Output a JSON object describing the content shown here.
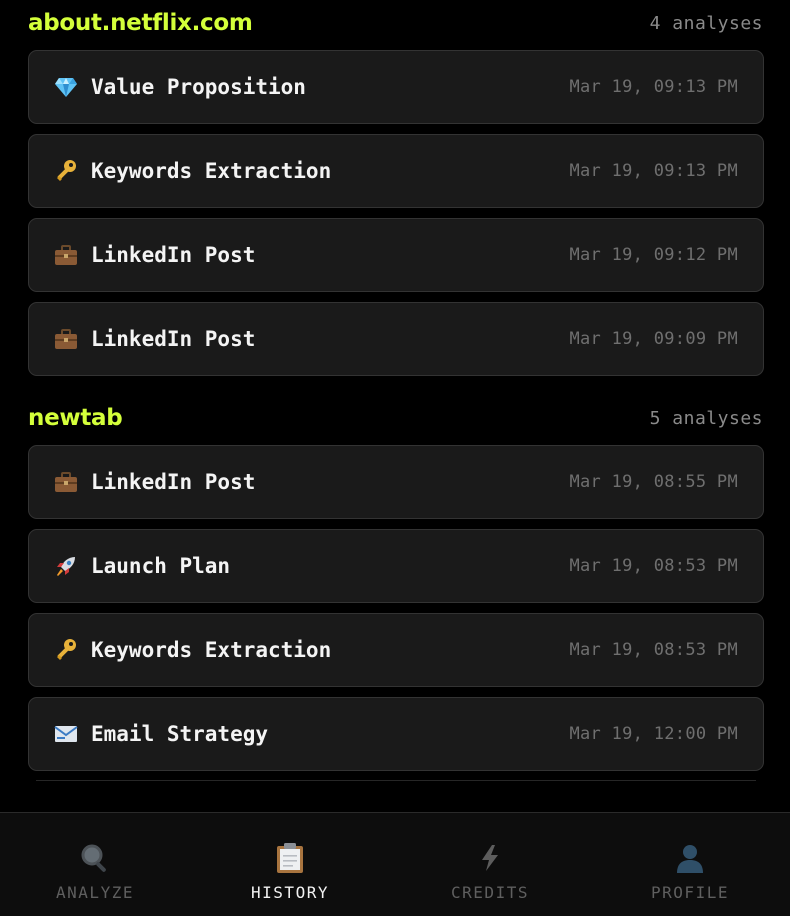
{
  "groups": [
    {
      "title": "about.netflix.com",
      "count": "4 analyses",
      "items": [
        {
          "icon": "gem-icon",
          "title": "Value Proposition",
          "time": "Mar 19, 09:13 PM"
        },
        {
          "icon": "key-icon",
          "title": "Keywords Extraction",
          "time": "Mar 19, 09:13 PM"
        },
        {
          "icon": "briefcase-icon",
          "title": "LinkedIn Post",
          "time": "Mar 19, 09:12 PM"
        },
        {
          "icon": "briefcase-icon",
          "title": "LinkedIn Post",
          "time": "Mar 19, 09:09 PM"
        }
      ]
    },
    {
      "title": "newtab",
      "count": "5 analyses",
      "items": [
        {
          "icon": "briefcase-icon",
          "title": "LinkedIn Post",
          "time": "Mar 19, 08:55 PM"
        },
        {
          "icon": "rocket-icon",
          "title": "Launch Plan",
          "time": "Mar 19, 08:53 PM"
        },
        {
          "icon": "key-icon",
          "title": "Keywords Extraction",
          "time": "Mar 19, 08:53 PM"
        },
        {
          "icon": "email-icon",
          "title": "Email Strategy",
          "time": "Mar 19, 12:00 PM"
        }
      ]
    }
  ],
  "nav": [
    {
      "icon": "magnifier-icon",
      "label": "ANALYZE",
      "active": false
    },
    {
      "icon": "clipboard-icon",
      "label": "HISTORY",
      "active": true
    },
    {
      "icon": "lightning-icon",
      "label": "CREDITS",
      "active": false
    },
    {
      "icon": "user-icon",
      "label": "PROFILE",
      "active": false
    }
  ],
  "colors": {
    "accent": "#d4ff3a",
    "background": "#000000",
    "card": "#1a1a1a"
  }
}
